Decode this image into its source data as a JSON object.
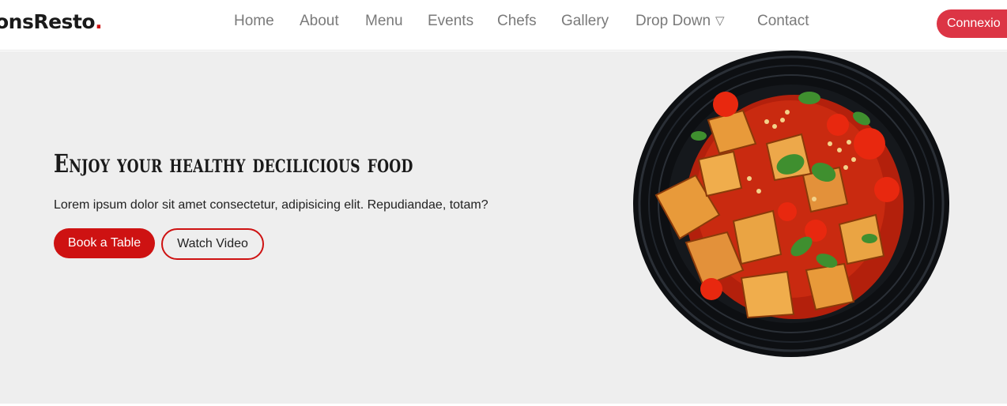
{
  "header": {
    "logo_text": "onsResto",
    "logo_dot": ".",
    "nav": [
      {
        "label": "Home"
      },
      {
        "label": "About"
      },
      {
        "label": "Menu"
      },
      {
        "label": "Events"
      },
      {
        "label": "Chefs"
      },
      {
        "label": "Gallery"
      },
      {
        "label": "Drop Down"
      },
      {
        "label": "Contact"
      }
    ],
    "cta_label": "Connexio"
  },
  "hero": {
    "title": "Enjoy your healthy decilicious food",
    "subtitle": "Lorem ipsum dolor sit amet consectetur, adipisicing elit. Repudiandae, totam?",
    "primary_button": "Book a Table",
    "secondary_button": "Watch Video",
    "image_icon": "food-plate-image"
  },
  "colors": {
    "accent": "#ce1212",
    "cta": "#dc3545",
    "hero_bg": "#eeeeee",
    "nav_text": "#7a7a7a"
  }
}
